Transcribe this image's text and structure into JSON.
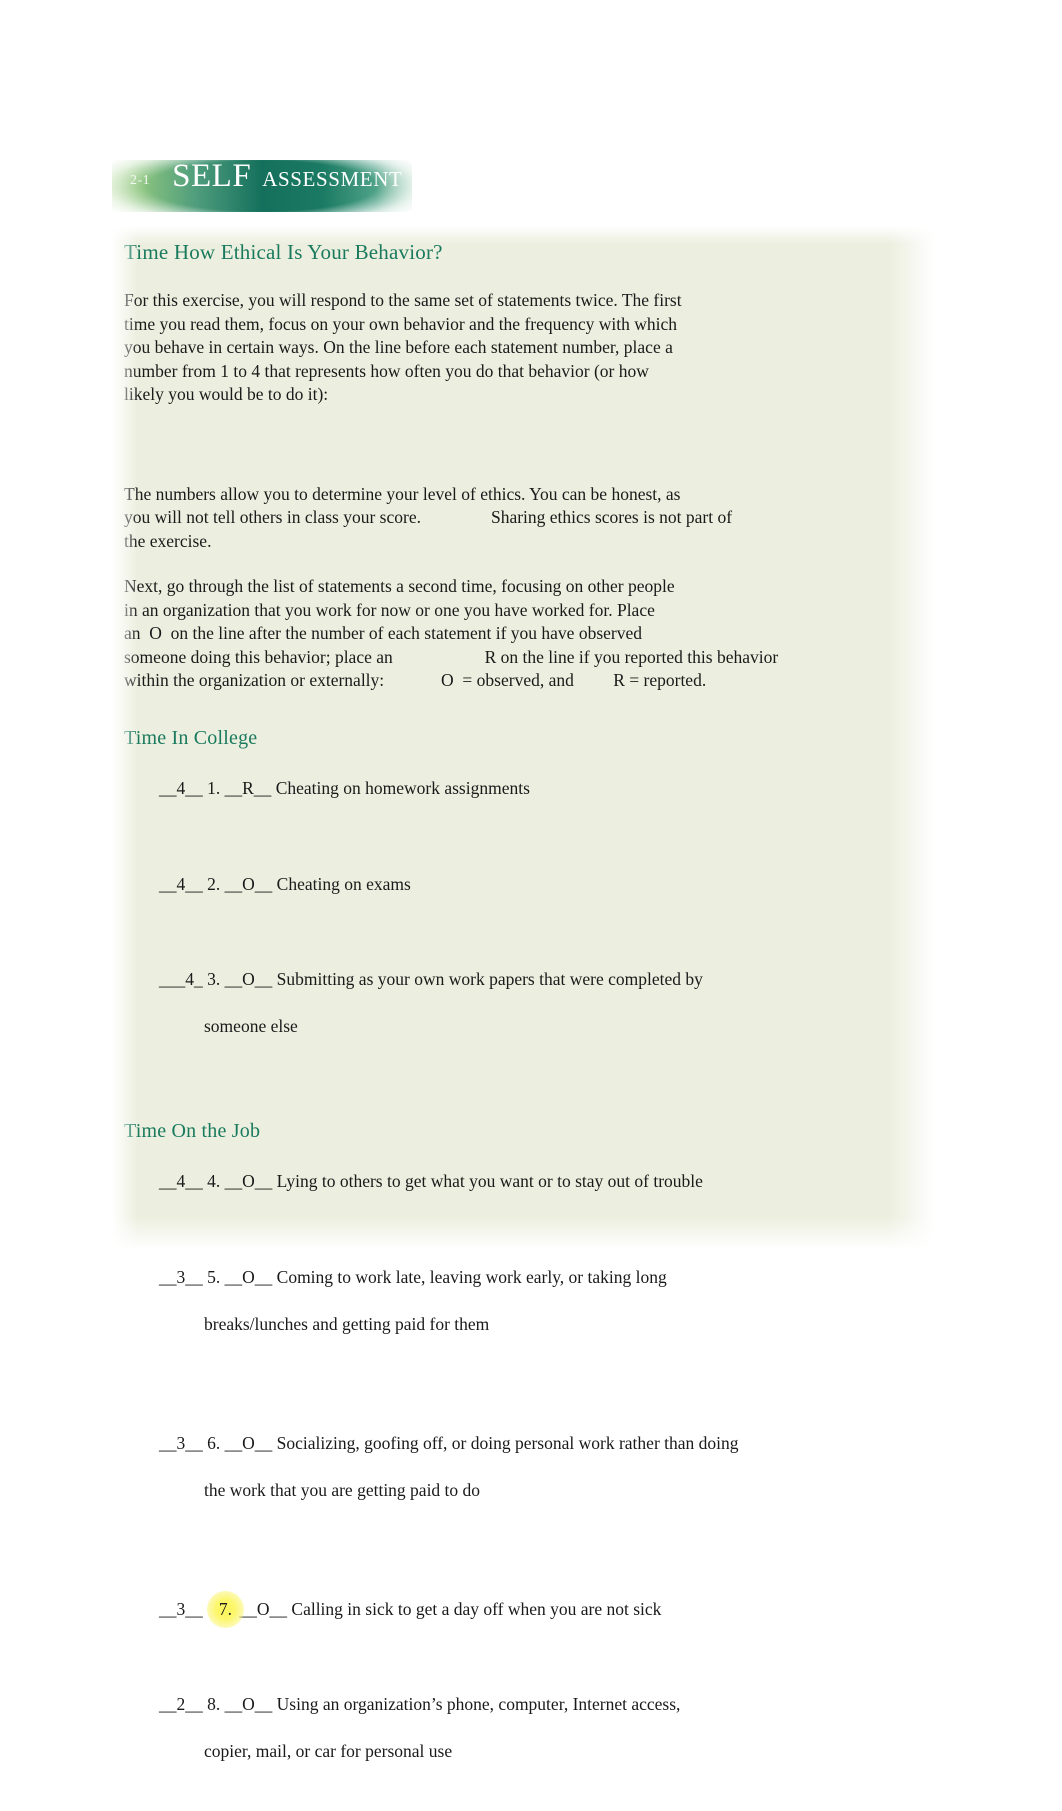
{
  "banner": {
    "number": "2-1",
    "word_primary": "SELF",
    "word_secondary": "ASSESSMENT",
    "gradient_start": "#b9dca4",
    "gradient_mid": "#14705c",
    "gradient_end": "#b9dcc9",
    "text_color": "#ffffff"
  },
  "panel": {
    "background_color": "#ecefdf",
    "heading_color": "#1a7a5e",
    "body_color": "#1a1a1a",
    "highlight_color": "#fbf55c"
  },
  "document": {
    "title": "Time How Ethical Is Your Behavior?",
    "paragraph_1": "For this exercise, you will respond to the same set of statements twice. The first\ntime you read them, focus on your own behavior and the frequency with which\nyou behave in certain ways. On the line before each statement number, place a\nnumber from 1 to 4 that represents how often you do that behavior (or how\nlikely you would be to do it):",
    "paragraph_2": "The numbers allow you to determine your level of ethics. You can be honest, as\nyou will not tell others in class your score.    Sharing ethics scores is not part of\nthe exercise.",
    "paragraph_3": "Next, go through the list of statements a second time, focusing on other people\nin an organization that you work for now or one you have worked for. Place\nan  O  on the line after the number of each statement if you have observed\nsomeone doing this behavior; place an      R on the line if you reported this behavior\nwithin the organization or externally:    O  = observed, and   R = reported."
  },
  "sections": [
    {
      "heading": "Time In College",
      "items": [
        {
          "rating": "__4__",
          "number": "1.",
          "code": "__R__",
          "text": "Cheating on homework assignments",
          "continuation": "",
          "highlighted": false
        },
        {
          "rating": "__4__",
          "number": "2.",
          "code": "__O__",
          "text": "Cheating on exams",
          "continuation": "",
          "highlighted": false
        },
        {
          "rating": "___4_",
          "number": "3.",
          "code": "__O__",
          "text": "Submitting as your own work papers that were completed by",
          "continuation": "someone else",
          "highlighted": false
        }
      ]
    },
    {
      "heading": "Time On the Job",
      "items": [
        {
          "rating": "__4__",
          "number": "4.",
          "code": "__O__",
          "text": "Lying to others to get what you want or to stay out of trouble",
          "continuation": "",
          "highlighted": false
        },
        {
          "rating": "__3__",
          "number": "5.",
          "code": "__O__",
          "text": "Coming to work late, leaving work early, or taking long",
          "continuation": "breaks/lunches and getting paid for them",
          "highlighted": false
        },
        {
          "rating": "__3__",
          "number": "6.",
          "code": "__O__",
          "text": "Socializing, goofing off, or doing personal work rather than doing",
          "continuation": "the work that you are getting paid to do",
          "highlighted": false
        },
        {
          "rating": "__3__ ",
          "number": "7.",
          "code": "__O__",
          "text": "Calling in sick to get a day off when you are not sick",
          "continuation": "",
          "highlighted": true
        },
        {
          "rating": "__2__",
          "number": "8.",
          "code": "__O__",
          "text": "Using an organization’s phone, computer, Internet access,",
          "continuation": "copier, mail, or car for personal use",
          "highlighted": false
        }
      ]
    }
  ]
}
